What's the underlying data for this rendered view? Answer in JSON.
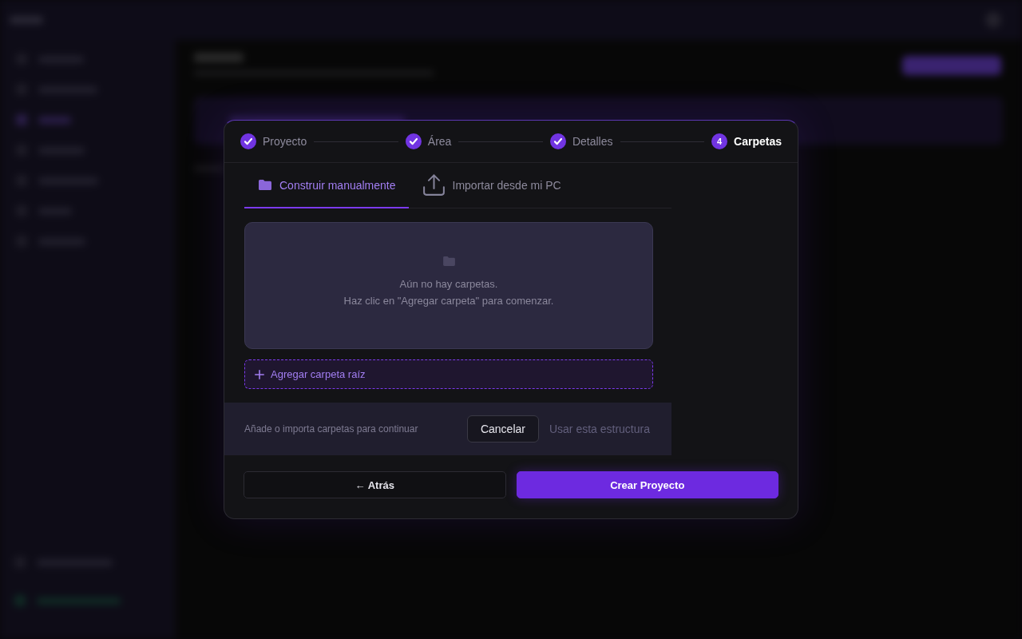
{
  "stepper": {
    "steps": [
      {
        "label": "Proyecto",
        "completed": true,
        "selected": false
      },
      {
        "label": "Área",
        "completed": true,
        "selected": false
      },
      {
        "label": "Detalles",
        "completed": true,
        "selected": false
      },
      {
        "label": "Carpetas",
        "completed": false,
        "selected": true,
        "number": "4"
      }
    ]
  },
  "tabs": [
    {
      "label": "Construir manualmente",
      "kind": "manual",
      "selected": true
    },
    {
      "label": "Importar desde mi PC",
      "kind": "import",
      "selected": false
    }
  ],
  "empty_state": {
    "message": "Aún no hay carpetas.",
    "hint": "Haz clic en \"Agregar carpeta\" para comenzar."
  },
  "add_root_button": {
    "label": "Agregar carpeta raíz"
  },
  "footer": {
    "message": "Añade o importa carpetas para continuar",
    "buttons": [
      {
        "label": "Cancelar",
        "kind": "secondary",
        "disabled": false
      },
      {
        "label": "Usar esta estructura",
        "kind": "primary",
        "disabled": true
      }
    ]
  },
  "actions": [
    {
      "label": "← Atrás",
      "kind": "secondary"
    },
    {
      "label": "Crear Proyecto",
      "kind": "primary"
    }
  ]
}
